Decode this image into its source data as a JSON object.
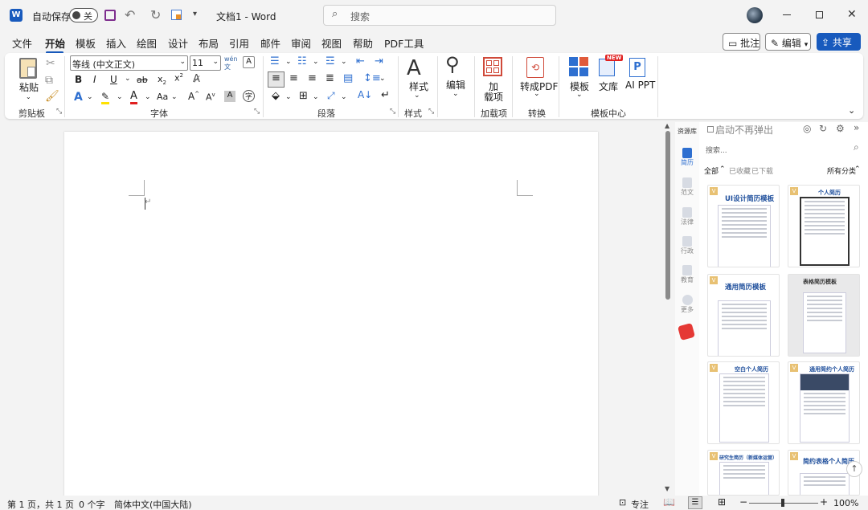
{
  "title_bar": {
    "autosave_label": "自动保存",
    "autosave_state": "关",
    "doc_title": "文档1 - Word",
    "search_placeholder": "搜索"
  },
  "tabs": [
    "文件",
    "开始",
    "模板",
    "插入",
    "绘图",
    "设计",
    "布局",
    "引用",
    "邮件",
    "审阅",
    "视图",
    "帮助",
    "PDF工具"
  ],
  "active_tab": "开始",
  "header_buttons": {
    "comments": "批注",
    "editing": "编辑",
    "share": "共享"
  },
  "ribbon": {
    "clipboard": {
      "paste": "粘贴",
      "group": "剪贴板"
    },
    "font": {
      "font_name": "等线 (中文正文)",
      "font_size": "11",
      "group": "字体"
    },
    "paragraph": {
      "group": "段落"
    },
    "styles": {
      "label": "样式",
      "group": "样式"
    },
    "editing": {
      "label": "编辑"
    },
    "addins": {
      "label_1": "加",
      "label_2": "载项",
      "group": "加载项"
    },
    "convert": {
      "label": "转成PDF",
      "group": "转换"
    },
    "templates": {
      "template": "模板",
      "library": "文库",
      "new_badge": "NEW",
      "ai_ppt": "AI PPT",
      "group": "模板中心"
    }
  },
  "side_panel": {
    "rail": [
      {
        "label": "资源库"
      },
      {
        "label": "简历"
      },
      {
        "label": "范文"
      },
      {
        "label": "法律"
      },
      {
        "label": "行政"
      },
      {
        "label": "教育"
      },
      {
        "label": "更多"
      }
    ],
    "no_popup": "启动不再弹出",
    "search_placeholder": "搜索...",
    "filters": {
      "all": "全部",
      "favorited": "已收藏",
      "downloaded": "已下载",
      "categories": "所有分类"
    },
    "cards": [
      {
        "title": "UI设计简历模板"
      },
      {
        "title": "个人简历"
      },
      {
        "title": "通用简历模板"
      },
      {
        "title": "表格简历模板"
      },
      {
        "title": "空白个人简历"
      },
      {
        "title": "通用简约个人简历"
      },
      {
        "title": "研究生简历（新媒体运营）"
      },
      {
        "title": "简约表格个人简历"
      }
    ]
  },
  "status_bar": {
    "page": "第 1 页，共 1 页",
    "words": "0 个字",
    "language": "简体中文(中国大陆)",
    "focus": "专注",
    "zoom": "100%"
  }
}
